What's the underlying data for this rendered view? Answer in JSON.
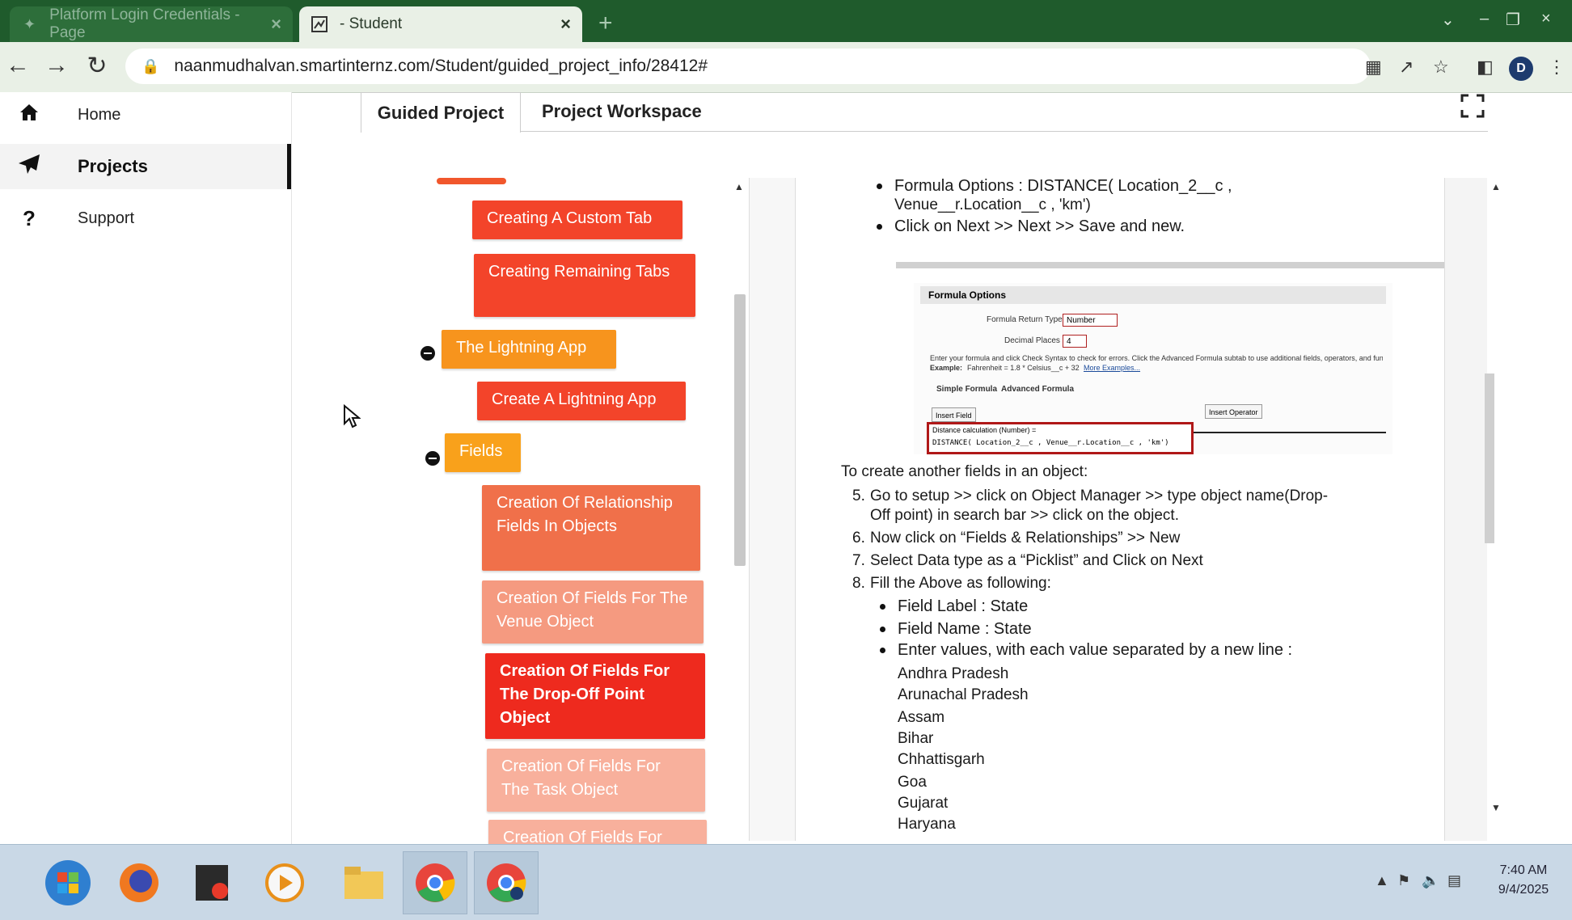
{
  "browser": {
    "tabs": [
      {
        "title": "Platform Login Credentials - Page",
        "active": false
      },
      {
        "title": "- Student",
        "active": true
      }
    ],
    "url": "naanmudhalvan.smartinternz.com/Student/guided_project_info/28412#",
    "profile_initial": "D"
  },
  "sidebar": {
    "items": [
      {
        "label": "Home",
        "icon": "home-icon"
      },
      {
        "label": "Projects",
        "icon": "paper-plane-icon",
        "active": true
      },
      {
        "label": "Support",
        "icon": "question-icon"
      }
    ]
  },
  "content_tabs": [
    {
      "label": "Guided Project",
      "active": true
    },
    {
      "label": "Project Workspace",
      "active": false
    }
  ],
  "tree": {
    "nodes": [
      {
        "label": "Creating A Custom Tab",
        "color": "#f3442a"
      },
      {
        "label": "Creating Remaining Tabs",
        "color": "#f3442a"
      },
      {
        "label": "The Lightning App",
        "color": "#f7941d"
      },
      {
        "label": "Create A Lightning App",
        "color": "#f3442a"
      },
      {
        "label": "Fields",
        "color": "#f9a11b"
      },
      {
        "label": "Creation Of Relationship Fields In Objects",
        "color": "#f0704a"
      },
      {
        "label": "Creation Of Fields For The Venue Object",
        "color": "#f59a80"
      },
      {
        "label": "Creation Of Fields For The Drop-Off Point Object",
        "color": "#ee2a1e"
      },
      {
        "label": "Creation Of Fields For The Task Object",
        "color": "#f8b09c"
      },
      {
        "label": "Creation Of Fields For",
        "color": "#f8b09c"
      }
    ]
  },
  "instructions": {
    "top_bullets": [
      "Formula Options : DISTANCE( Location_2__c ,",
      "Venue__r.Location__c , 'km')",
      "Click on Next >> Next >> Save and new."
    ],
    "embedded_screenshot": {
      "header": "Formula Options",
      "return_type_label": "Formula Return Type",
      "return_type_value": "Number",
      "decimal_label": "Decimal Places",
      "decimal_value": "4",
      "help_text": "Enter your formula and click Check Syntax to check for errors. Click the Advanced Formula subtab to use additional fields, operators, and functions.",
      "example_label": "Example:",
      "example_text": "Fahrenheit = 1.8 * Celsius__c + 32",
      "more_examples": "More Examples...",
      "tab_simple": "Simple Formula",
      "tab_advanced": "Advanced Formula",
      "insert_field": "Insert Field",
      "insert_operator": "Insert Operator",
      "formula_label": "Distance calculation (Number) =",
      "formula_text": "DISTANCE( Location_2__c , Venue__r.Location__c , 'km')"
    },
    "intro": "To create another fields in an object:",
    "steps": [
      {
        "num": "5.",
        "lines": [
          "Go to setup >> click on Object Manager >> type object name(Drop-",
          "Off point) in search bar >> click on the object."
        ]
      },
      {
        "num": "6.",
        "lines": [
          "Now click on “Fields & Relationships” >> New"
        ]
      },
      {
        "num": "7.",
        "lines": [
          "Select Data type as a “Picklist” and Click on Next"
        ]
      },
      {
        "num": "8.",
        "lines": [
          "Fill the Above as following:"
        ]
      }
    ],
    "sub_bullets": [
      "Field Label : State",
      "Field Name : State",
      "Enter values, with each value separated by a new line :"
    ],
    "values": [
      "Andhra Pradesh",
      "Arunachal Pradesh",
      "Assam",
      "Bihar",
      "Chhattisgarh",
      "Goa",
      "Gujarat",
      "Haryana"
    ]
  },
  "taskbar": {
    "clock_time": "7:40 AM",
    "clock_date": "9/4/2025"
  }
}
